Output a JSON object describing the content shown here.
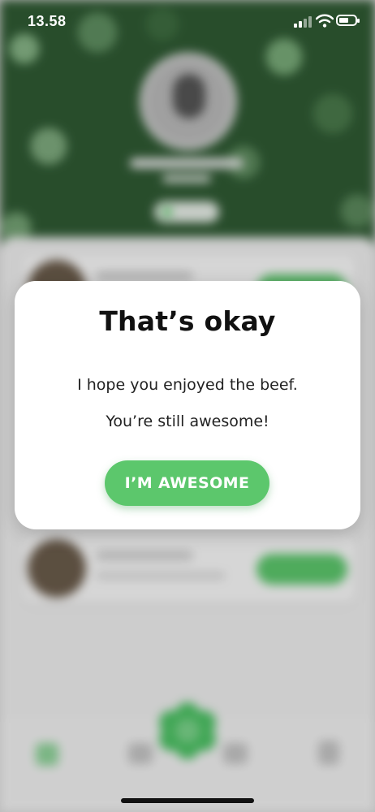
{
  "status_bar": {
    "time": "13.58"
  },
  "dialog": {
    "title": "That’s okay",
    "line1": "I hope you enjoyed the beef.",
    "line2": "You’re still awesome!",
    "button_label": "I’M AWESOME"
  },
  "colors": {
    "accent": "#5cc76c",
    "dialog_bg": "#ffffff",
    "title_text": "#111111"
  },
  "icons": {
    "nav_home": "home-icon",
    "nav_community": "community-icon",
    "nav_center": "flower-icon",
    "nav_stats": "stats-icon",
    "nav_profile": "profile-icon",
    "status": [
      "signal-icon",
      "wifi-icon",
      "battery-icon"
    ]
  }
}
